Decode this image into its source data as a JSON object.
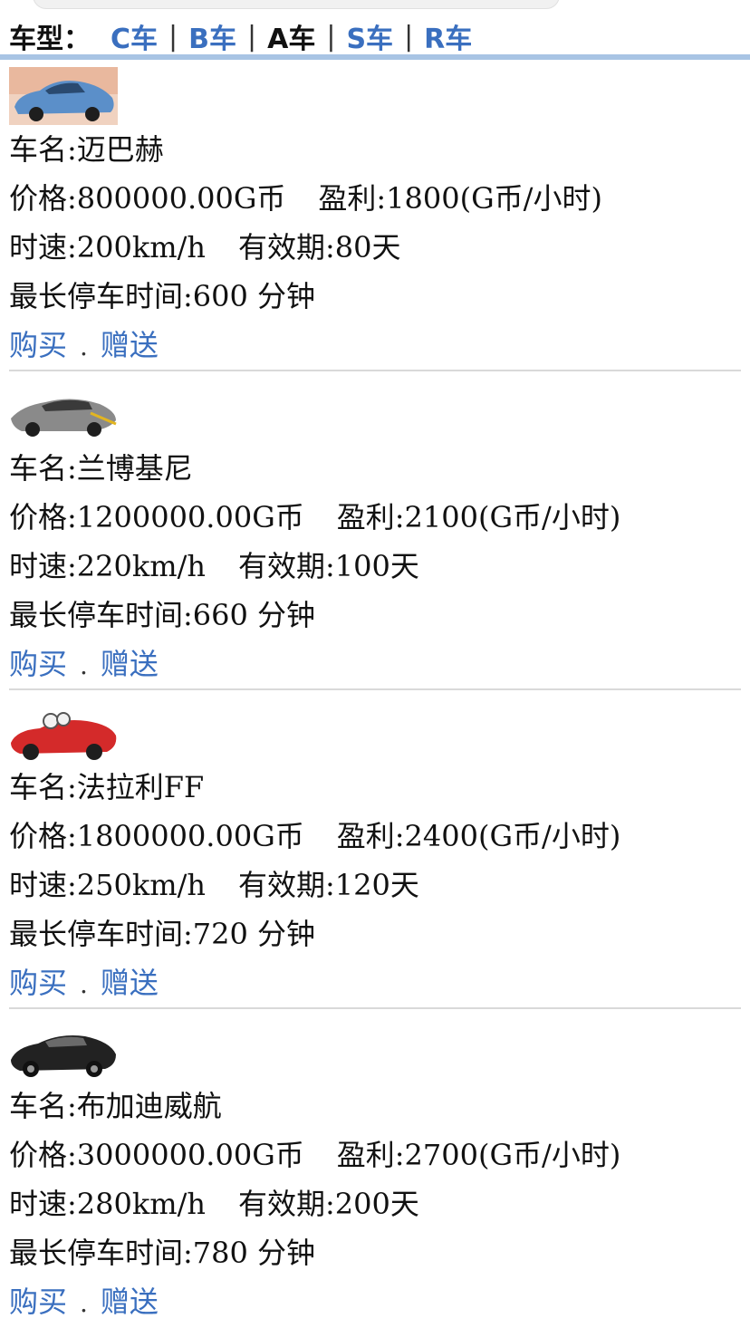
{
  "filter": {
    "label": "车型：",
    "tabs": [
      {
        "label": "C车",
        "active": false
      },
      {
        "label": "B车",
        "active": false
      },
      {
        "label": "A车",
        "active": true
      },
      {
        "label": "S车",
        "active": false
      },
      {
        "label": "R车",
        "active": false
      }
    ],
    "separator": "|"
  },
  "cars": [
    {
      "name": "车名:迈巴赫",
      "price": "价格:800000.00G币",
      "profit": "盈利:1800(G币/小时)",
      "speed": "时速:200km/h",
      "validity": "有效期:80天",
      "parking": "最长停车时间:600 分钟",
      "buy": "购买",
      "dot": ".",
      "gift": "赠送",
      "color": "#5b8fc9"
    },
    {
      "name": "车名:兰博基尼",
      "price": "价格:1200000.00G币",
      "profit": "盈利:2100(G币/小时)",
      "speed": "时速:220km/h",
      "validity": "有效期:100天",
      "parking": "最长停车时间:660 分钟",
      "buy": "购买",
      "dot": ".",
      "gift": "赠送",
      "color": "#8a8a8a"
    },
    {
      "name": "车名:法拉利FF",
      "price": "价格:1800000.00G币",
      "profit": "盈利:2400(G币/小时)",
      "speed": "时速:250km/h",
      "validity": "有效期:120天",
      "parking": "最长停车时间:720 分钟",
      "buy": "购买",
      "dot": ".",
      "gift": "赠送",
      "color": "#d42a2a"
    },
    {
      "name": "车名:布加迪威航",
      "price": "价格:3000000.00G币",
      "profit": "盈利:2700(G币/小时)",
      "speed": "时速:280km/h",
      "validity": "有效期:200天",
      "parking": "最长停车时间:780 分钟",
      "buy": "购买",
      "dot": ".",
      "gift": "赠送",
      "color": "#222222"
    }
  ]
}
